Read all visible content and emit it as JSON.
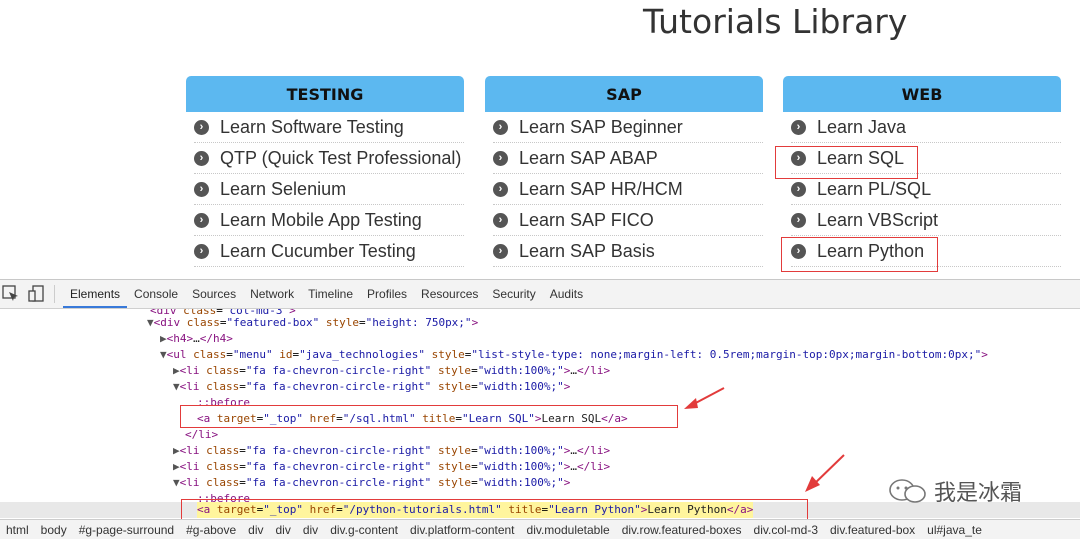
{
  "page": {
    "title": "Tutorials Library",
    "boxes": [
      {
        "heading": "TESTING",
        "items": [
          "Learn Software Testing",
          "QTP (Quick Test Professional)",
          "Learn Selenium",
          "Learn Mobile App Testing",
          "Learn Cucumber Testing"
        ]
      },
      {
        "heading": "SAP",
        "items": [
          "Learn SAP Beginner",
          "Learn SAP ABAP",
          "Learn SAP HR/HCM",
          "Learn SAP FICO",
          "Learn SAP Basis"
        ]
      },
      {
        "heading": "WEB",
        "items": [
          "Learn Java",
          "Learn SQL",
          "Learn PL/SQL",
          "Learn VBScript",
          "Learn Python"
        ]
      }
    ]
  },
  "devtools": {
    "tabs": [
      "Elements",
      "Console",
      "Sources",
      "Network",
      "Timeline",
      "Profiles",
      "Resources",
      "Security",
      "Audits"
    ],
    "active_tab": "Elements",
    "breadcrumbs": [
      "html",
      "body",
      "#g-page-surround",
      "#g-above",
      "div",
      "div",
      "div",
      "div.g-content",
      "div.platform-content",
      "div.moduletable",
      "div.row.featured-boxes",
      "div.col-md-3",
      "div.featured-box",
      "ul#java_te"
    ]
  },
  "watermark": {
    "text": "我是冰霜"
  },
  "colors": {
    "box_header": "#5cb8f0",
    "highlight": "#e23b3b",
    "selected_line": "#fff59d"
  }
}
